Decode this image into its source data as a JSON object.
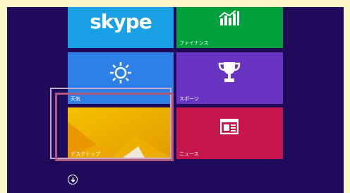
{
  "tiles": {
    "skype": {
      "logo_text": "skype",
      "label": ""
    },
    "finance": {
      "label": "ファイナンス"
    },
    "weather": {
      "label": "天気"
    },
    "sports": {
      "label": "スポーツ"
    },
    "desktop": {
      "label": "デスクトップ"
    },
    "news": {
      "label": "ニュース"
    }
  },
  "colors": {
    "screen_background": "#1f0a5a",
    "skype_tile": "#1aa0e4",
    "finance_tile": "#00a03c",
    "weather_tile": "#2e7fe8",
    "sports_tile": "#6a34c3",
    "desktop_tile": "#f1b600",
    "news_tile": "#c4164a",
    "highlight_outer": "#c9a7c8",
    "highlight_inner": "#b0597b"
  },
  "icons": {
    "scroll_down": "arrow-down-circle-icon",
    "finance": "bar-chart-icon",
    "weather": "sun-icon",
    "sports": "trophy-icon",
    "news": "newspaper-icon"
  }
}
